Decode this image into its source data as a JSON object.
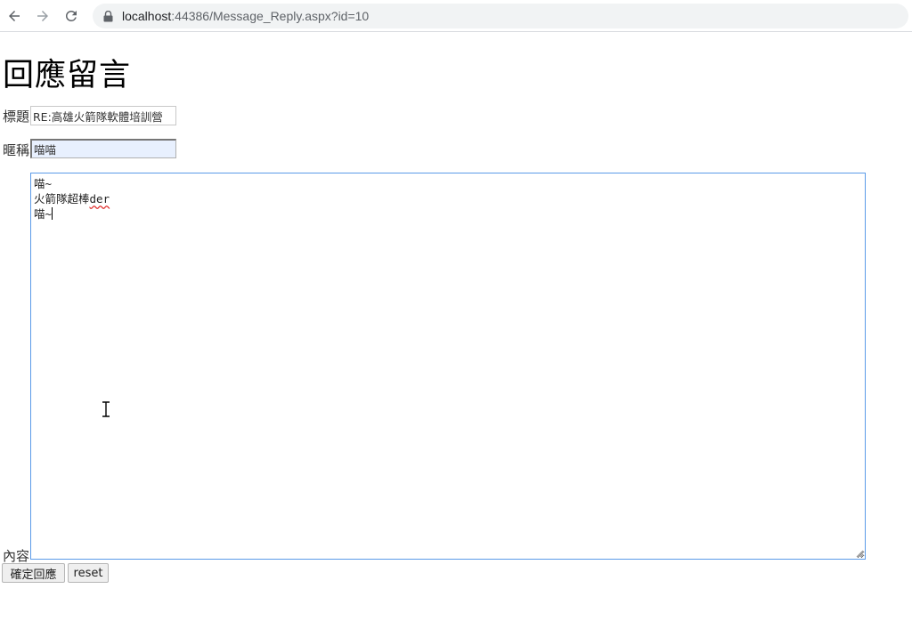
{
  "browser": {
    "url_host": "localhost",
    "url_rest": ":44386/Message_Reply.aspx?id=10",
    "icons": [
      "back-arrow-icon",
      "forward-arrow-icon",
      "reload-icon",
      "lock-icon"
    ]
  },
  "page": {
    "title": "回應留言"
  },
  "form": {
    "title_label": "標題",
    "title_value": "RE:高雄火箭隊軟體培訓營",
    "nickname_label": "暱稱",
    "nickname_value": "喵喵",
    "content_label": "內容",
    "content_lines": [
      "喵~",
      "火箭隊超棒",
      "der",
      "喵~"
    ],
    "submit_label": "確定回應",
    "reset_label": "reset"
  },
  "colors": {
    "textarea_focus_border": "#5b9be8",
    "autofill_background": "#e8f0fe",
    "spellcheck_underline": "#e0312f"
  }
}
